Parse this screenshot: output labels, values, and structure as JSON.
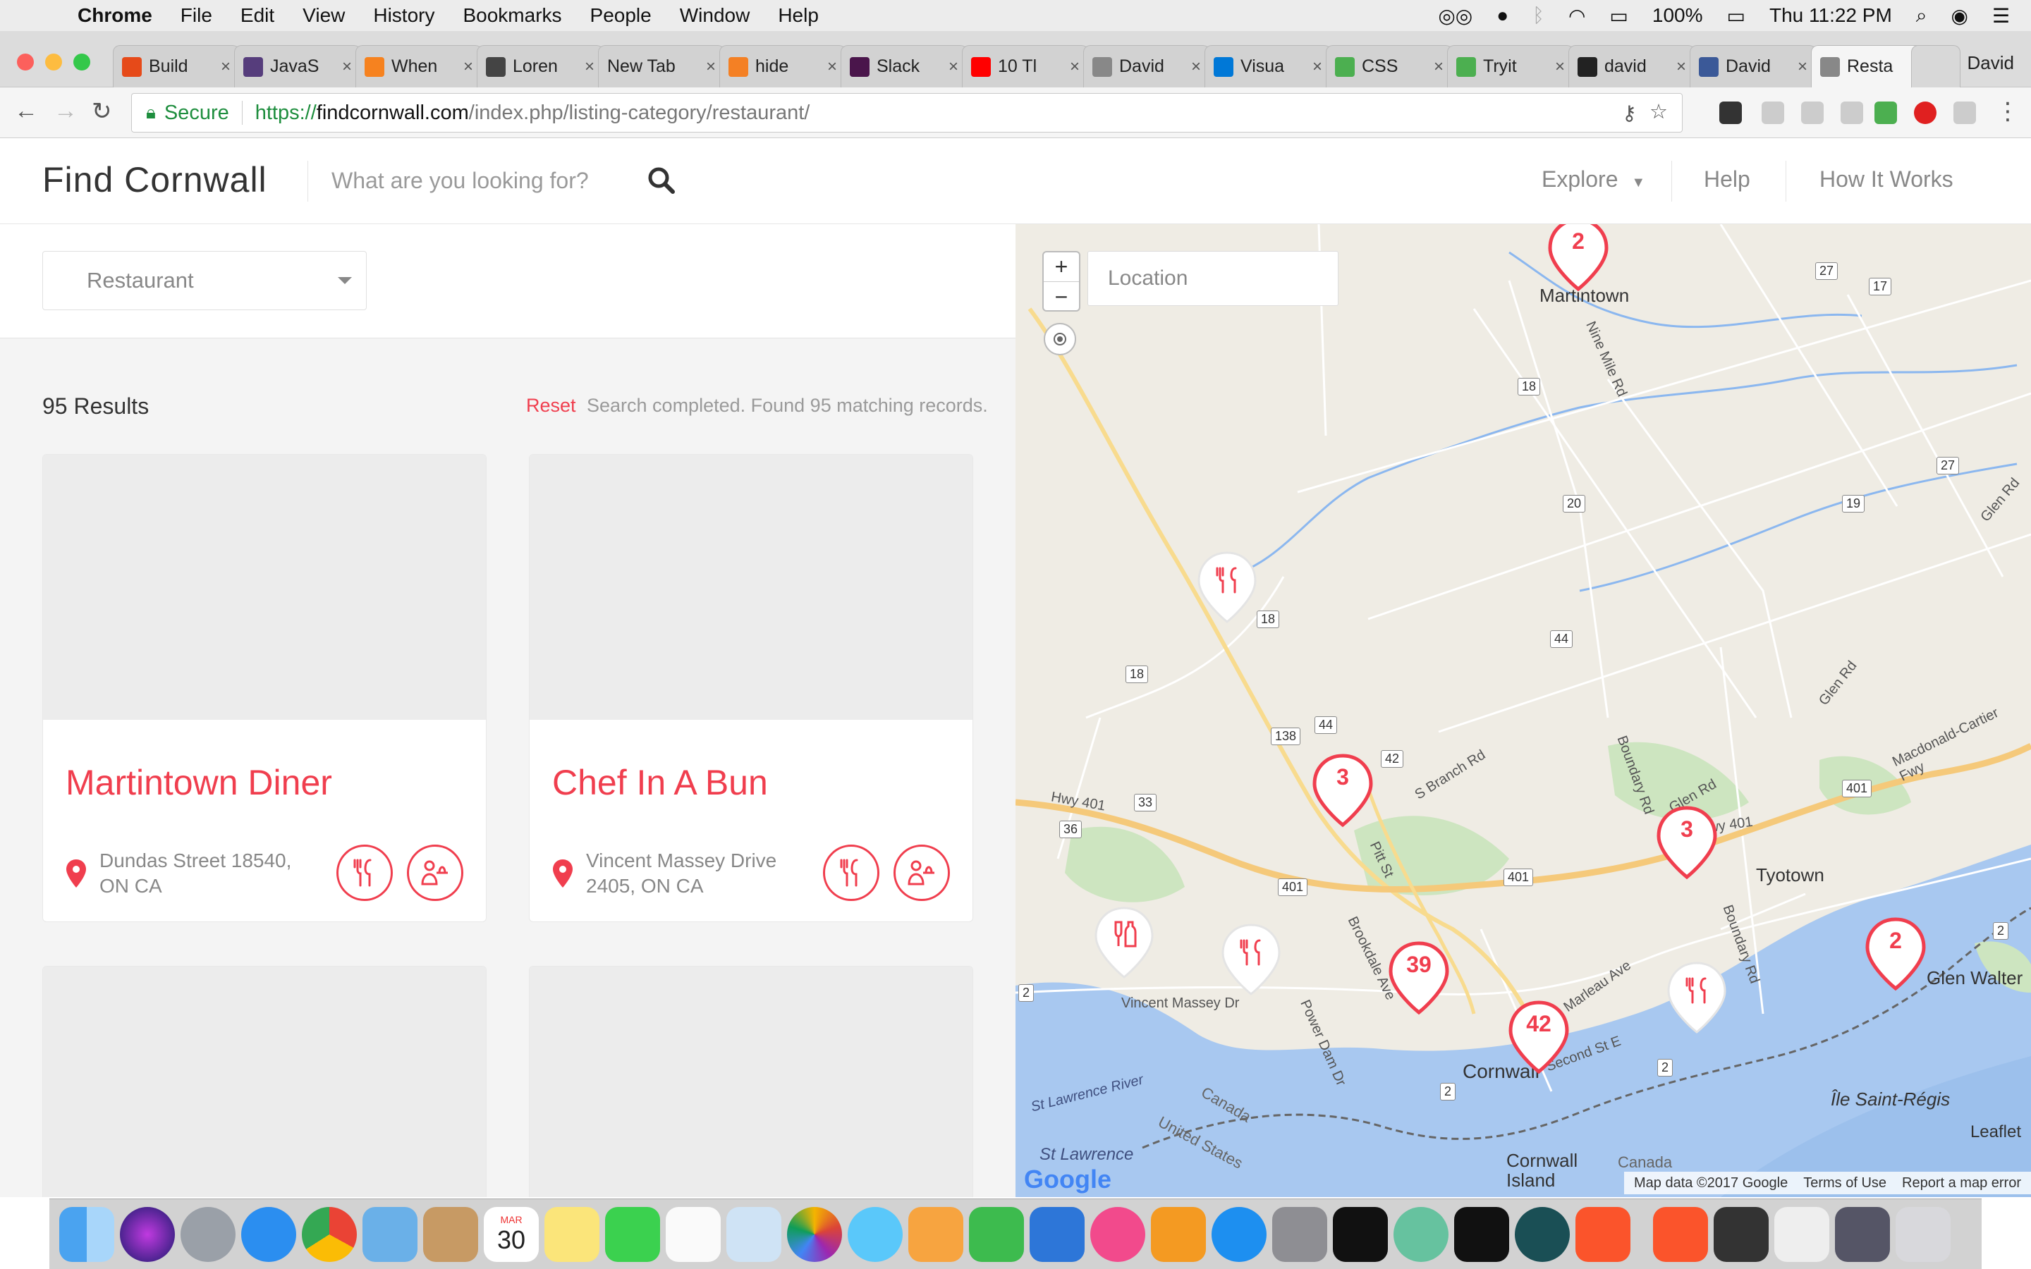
{
  "menubar": {
    "app_name": "Chrome",
    "menus": [
      "File",
      "Edit",
      "View",
      "History",
      "Bookmarks",
      "People",
      "Window",
      "Help"
    ],
    "battery": "100%",
    "clock": "Thu 11:22 PM"
  },
  "browser": {
    "tabs": [
      {
        "label": "Build",
        "color": "#e64a19"
      },
      {
        "label": "JavaS",
        "color": "#563d7c"
      },
      {
        "label": "When",
        "color": "#f6821f"
      },
      {
        "label": "Loren",
        "color": "#444444"
      },
      {
        "label": "New Tab",
        "color": ""
      },
      {
        "label": "hide",
        "color": "#f48024"
      },
      {
        "label": "Slack",
        "color": "#4a154b"
      },
      {
        "label": "10 Tl",
        "color": "#ff0000"
      },
      {
        "label": "David",
        "color": "#888888"
      },
      {
        "label": "Visua",
        "color": "#0078d7"
      },
      {
        "label": "CSS",
        "color": "#4caf50"
      },
      {
        "label": "Tryit",
        "color": "#4caf50"
      },
      {
        "label": "david",
        "color": "#222222"
      },
      {
        "label": "David",
        "color": "#3b5998"
      },
      {
        "label": "Resta",
        "color": "#888888"
      }
    ],
    "profile_name": "David",
    "secure_label": "Secure",
    "url_scheme": "https://",
    "url_host": "findcornwall.com",
    "url_path": "/index.php/listing-category/restaurant/"
  },
  "site": {
    "brand": "Find Cornwall",
    "search_placeholder": "What are you looking for?",
    "nav": [
      "Explore",
      "Help",
      "How It Works"
    ]
  },
  "filters": {
    "category": "Restaurant"
  },
  "results": {
    "count_label": "95 Results",
    "reset_label": "Reset",
    "status": "Search completed. Found 95 matching records."
  },
  "listings": [
    {
      "title": "Martintown Diner",
      "address_line1": "Dundas Street 18540,",
      "address_line2": "ON CA"
    },
    {
      "title": "Chef In A Bun",
      "address_line1": "Vincent Massey Drive",
      "address_line2": "2405, ON CA"
    }
  ],
  "map": {
    "location_placeholder": "Location",
    "clusters": [
      "2",
      "3",
      "3",
      "39",
      "42",
      "2"
    ],
    "places": [
      "Martintown",
      "Tyotown",
      "Cornwall",
      "Glen Walter",
      "Île Saint-Régis",
      "Cornwall Island",
      "Canada",
      "Canada",
      "United States",
      "St Lawrence"
    ],
    "roads": [
      "Nine Mile Rd",
      "Glen Rd",
      "Glen Rd",
      "S Branch Rd",
      "Boundary Rd",
      "Glen Rd",
      "Hwy 401",
      "Hwy 401",
      "Macdonald-Cartier Fwy",
      "Pitt St",
      "Brookdale Ave",
      "Vincent Massey Dr",
      "Power Dam Dr",
      "Second St E",
      "Marleau Ave",
      "Boundary Rd",
      "St Lawrence River"
    ],
    "shields": [
      "27",
      "17",
      "18",
      "20",
      "19",
      "27",
      "18",
      "18",
      "44",
      "44",
      "138",
      "42",
      "33",
      "36",
      "401",
      "401",
      "401",
      "2",
      "2",
      "2",
      "2"
    ],
    "zoom_in": "+",
    "zoom_out": "−",
    "attribution": "Map data ©2017 Google",
    "terms": "Terms of Use",
    "report": "Report a map error",
    "leaflet": "Leaflet",
    "google": "Google",
    "colors": {
      "accent": "#f03e4e",
      "water": "#a8c8f0",
      "park": "#cde5c0",
      "highway": "#f5c97a"
    }
  },
  "dock": {
    "calendar_month": "MAR",
    "calendar_day": "30"
  }
}
